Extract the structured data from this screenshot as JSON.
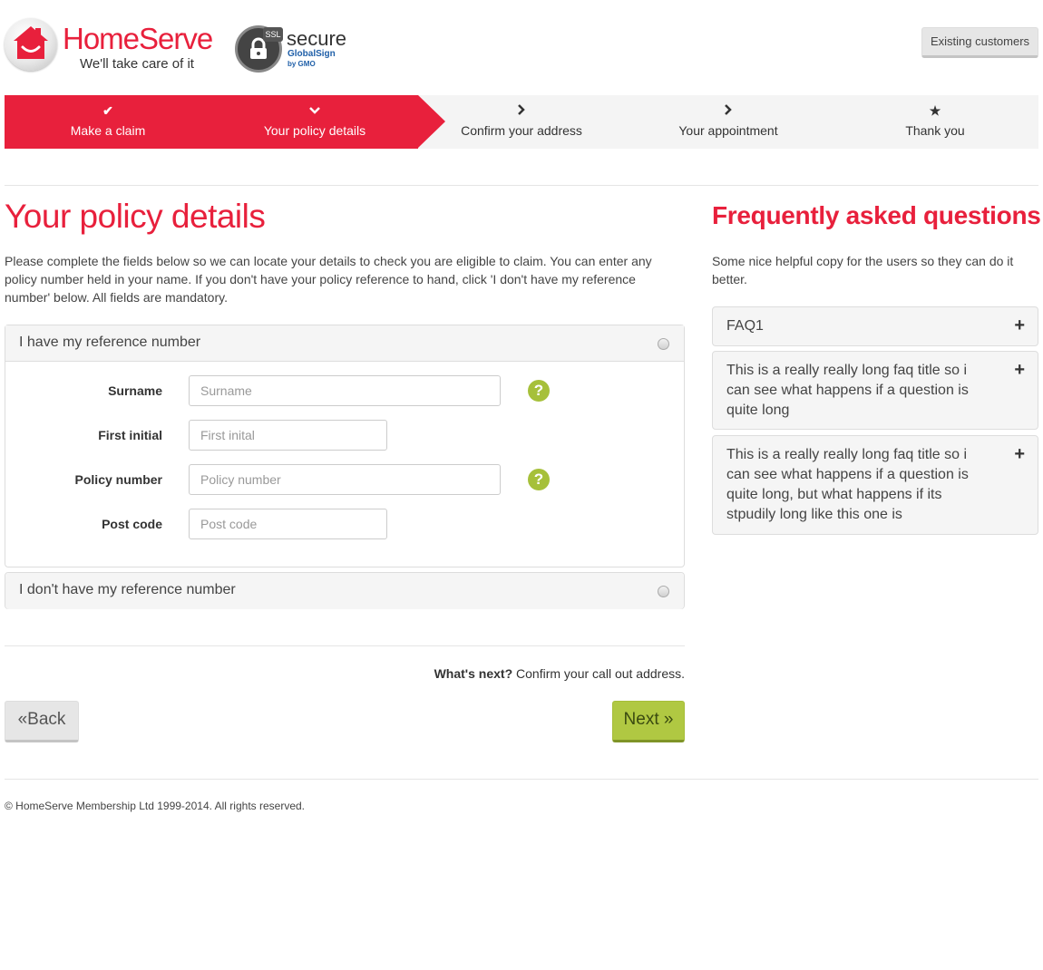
{
  "header": {
    "logo_name": "HomeServe",
    "logo_tagline": "We'll take care of it",
    "ssl_badge": "SSL",
    "ssl_secure": "secure",
    "ssl_provider": "GlobalSign",
    "ssl_provider_sub": "by GMO",
    "existing_customers": "Existing customers",
    "brand_color": "#e8203c"
  },
  "steps": [
    {
      "icon": "check-icon",
      "glyph": "✔",
      "label": "Make a claim",
      "state": "done"
    },
    {
      "icon": "chevron-down-icon",
      "glyph": "⌄",
      "label": "Your policy details",
      "state": "current"
    },
    {
      "icon": "chevron-right-icon",
      "glyph": "›",
      "label": "Confirm your address",
      "state": "todo"
    },
    {
      "icon": "chevron-right-icon",
      "glyph": "›",
      "label": "Your appointment",
      "state": "todo"
    },
    {
      "icon": "star-icon",
      "glyph": "★",
      "label": "Thank you",
      "state": "todo"
    }
  ],
  "main": {
    "title": "Your policy details",
    "intro": "Please complete the fields below so we can locate your details to check you are eligible to claim. You can enter any policy number held in your name. If you don't have your policy reference to hand, click 'I don't have my reference number' below. All fields are mandatory.",
    "option_have": "I have my reference number",
    "option_dont_have": "I don't have my reference number",
    "fields": [
      {
        "label": "Surname",
        "placeholder": "Surname",
        "value": "",
        "help": "?"
      },
      {
        "label": "First initial",
        "placeholder": "First inital",
        "value": ""
      },
      {
        "label": "Policy number",
        "placeholder": "Policy number",
        "value": "",
        "help": "?"
      },
      {
        "label": "Post code",
        "placeholder": "Post code",
        "value": ""
      }
    ],
    "whats_next_label": "What's next?",
    "whats_next_text": "Confirm your call out address.",
    "back_label": "«Back",
    "next_label": "Next »"
  },
  "faq": {
    "title": "Frequently asked questions",
    "intro": "Some nice helpful copy for the users so they can do it better.",
    "items": [
      "FAQ1",
      "This is a really really long faq title so i can see what happens if a question is quite long",
      "This is a really really long faq title so i can see what happens if a question is quite long, but what happens if its stpudily long like this one is"
    ],
    "expand_glyph": "+"
  },
  "footer": {
    "copyright": "© HomeServe Membership Ltd 1999-2014. All rights reserved."
  },
  "colors": {
    "accent": "#e8203c",
    "next_button": "#b0c842",
    "help_icon": "#a6c03a"
  }
}
